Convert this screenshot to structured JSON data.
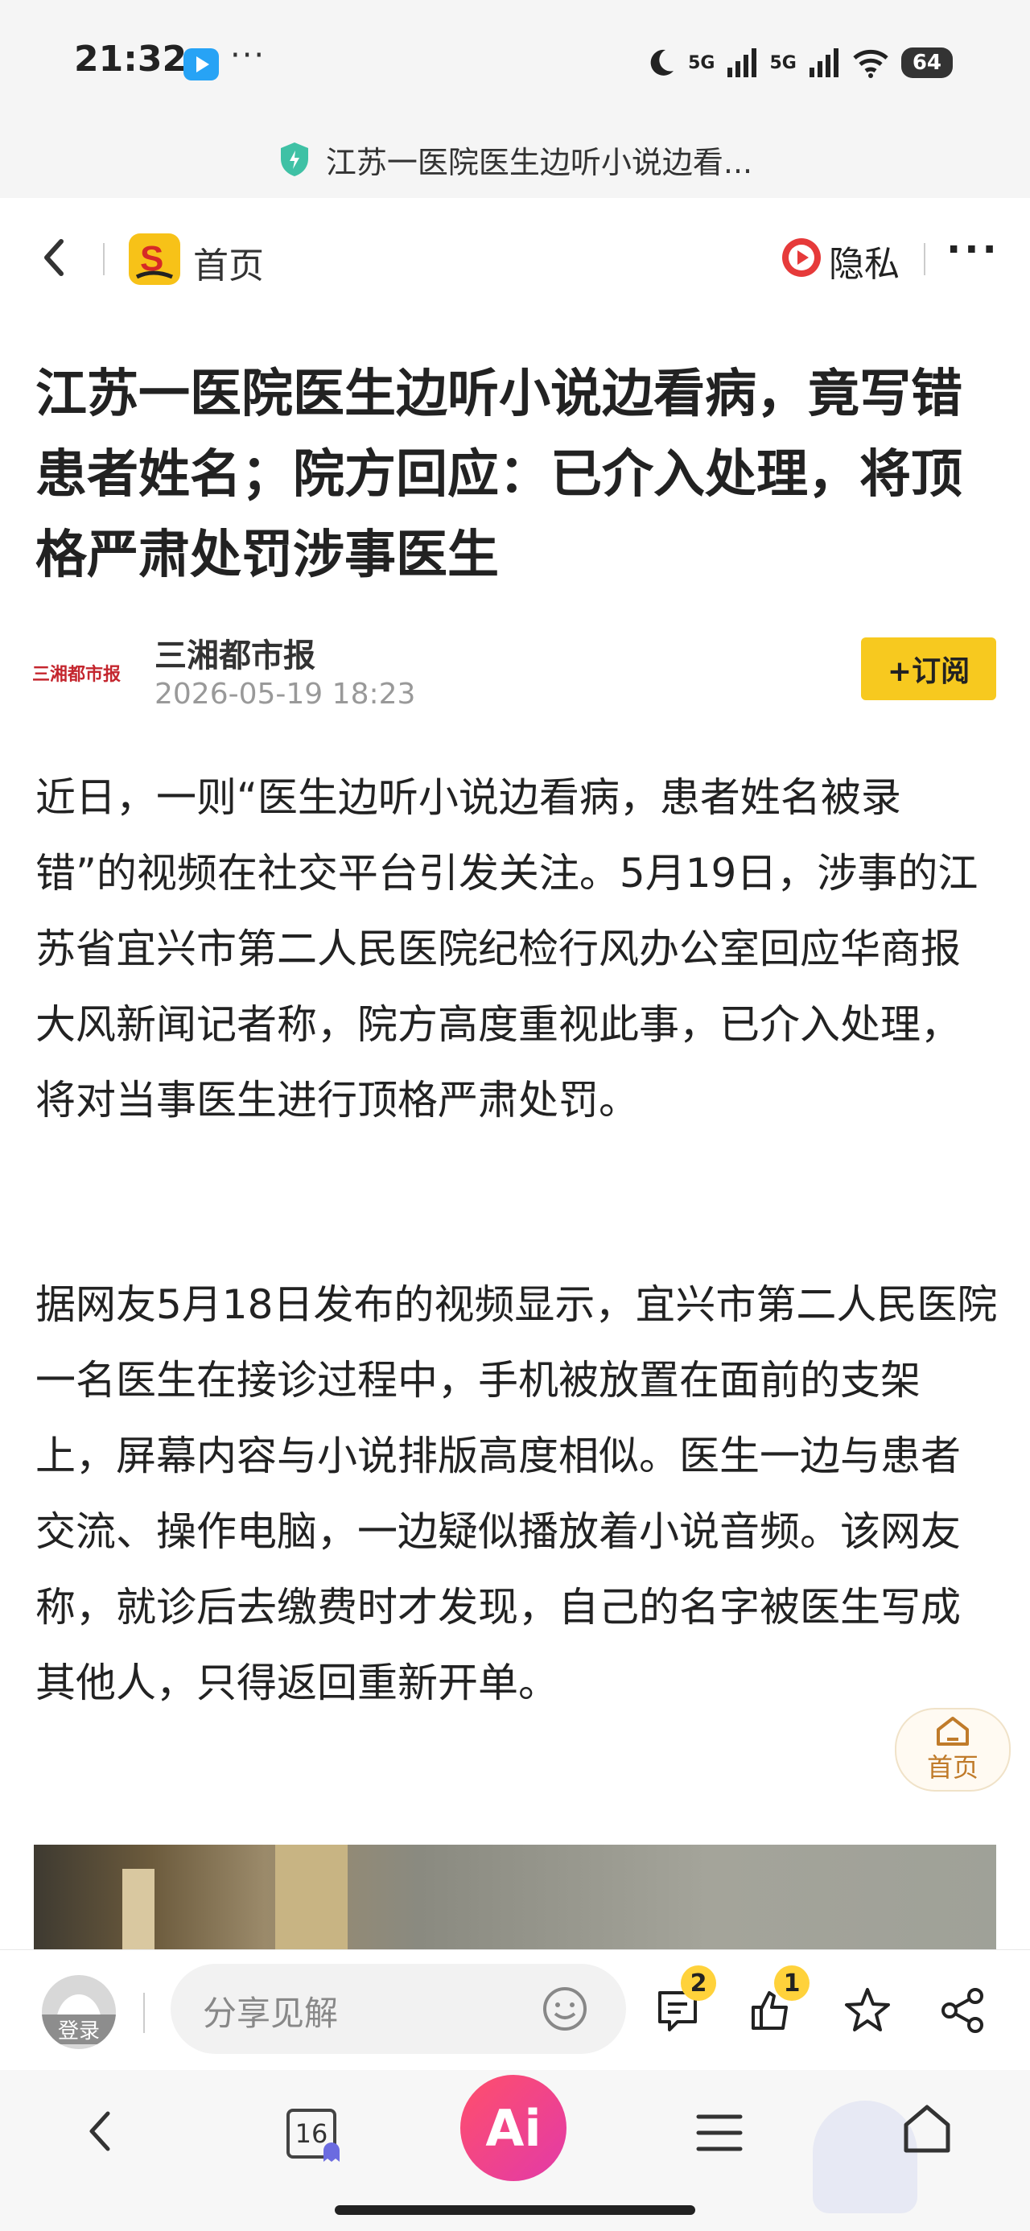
{
  "status_bar": {
    "time": "21:32",
    "more": "···",
    "signal_1": "5G",
    "signal_2": "5G",
    "battery": "64"
  },
  "url_bar": {
    "title": "江苏一医院医生边听小说边看..."
  },
  "nav": {
    "home_label": "首页",
    "privacy_label": "隐私",
    "more": "···"
  },
  "article": {
    "title": "江苏一医院医生边听小说边看病，竟写错患者姓名；院方回应：已介入处理，将顶格严肃处罚涉事医生",
    "source_logo_text": "三湘都市报",
    "author": "三湘都市报",
    "date": "2026-05-19 18:23",
    "subscribe_label": "+订阅",
    "paragraphs": [
      "近日，一则“医生边听小说边看病，患者姓名被录错”的视频在社交平台引发关注。5月19日，涉事的江苏省宜兴市第二人民医院纪检行风办公室回应华商报大风新闻记者称，院方高度重视此事，已介入处理，将对当事医生进行顶格严肃处罚。",
      "据网友5月18日发布的视频显示，宜兴市第二人民医院一名医生在接诊过程中，手机被放置在面前的支架上，屏幕内容与小说排版高度相似。医生一边与患者交流、操作电脑，一边疑似播放着小说音频。该网友称，就诊后去缴费时才发现，自己的名字被医生写成其他人，只得返回重新开单。"
    ]
  },
  "float_home": {
    "label": "首页"
  },
  "comment_bar": {
    "login_label": "登录",
    "share_placeholder": "分享见解",
    "comment_count": "2",
    "like_count": "1"
  },
  "bottom_nav": {
    "tabs_count": "16",
    "ai_label": "Ai"
  },
  "colors": {
    "accent_yellow": "#f7c91f",
    "ai_gradient": "#e23aa8",
    "source_red": "#c4262e"
  }
}
